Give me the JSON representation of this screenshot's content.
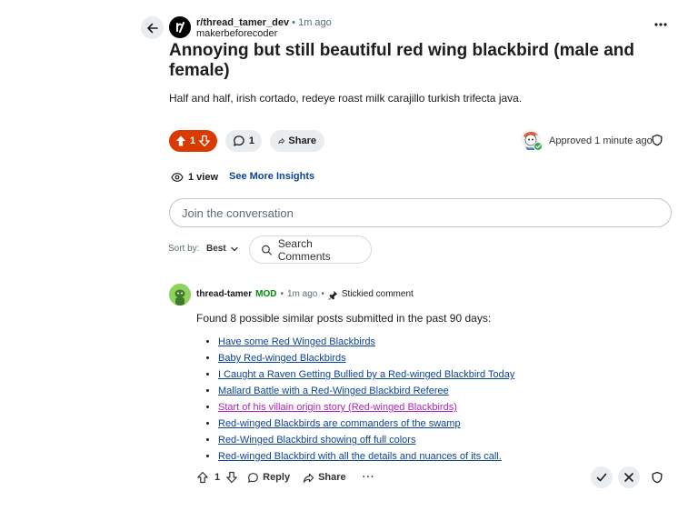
{
  "post": {
    "subreddit": "r/thread_tamer_dev",
    "separator": "•",
    "time": "1m ago",
    "author": "makerbeforecoder",
    "title": "Annoying but still beautiful red wing blackbird (male and female)",
    "body": "Half and half, irish cortado, redeye roast milk carajillo turkish trifecta java.",
    "score": "1",
    "comments_count": "1",
    "share_label": "Share",
    "approved_text": "Approved 1 minute ago",
    "views": "1 view",
    "insights_label": "See More Insights"
  },
  "composer": {
    "placeholder": "Join the conversation"
  },
  "sort": {
    "label": "Sort by:",
    "value": "Best",
    "search_label": "Search Comments"
  },
  "comment": {
    "author": "thread-tamer",
    "mod_badge": "MOD",
    "separator": "•",
    "time": "1m ago",
    "stickied": "Stickied comment",
    "text": "Found 8 possible similar posts submitted in the past 90 days:",
    "links": [
      "Have some Red Winged Blackbirds",
      "Baby Red-winged Blackbirds",
      "I Caught a Raven Getting Bullied by a Red-winged Blackbird Today",
      "Mallard Battle with a Red-Winged Blackbird Referee",
      "Start of his villain origin story (Red-winged Blackbirds)",
      "Red-winged Blackbirds are commanders of the swamp",
      "Red-Winged Blackbird showing off full colors",
      "Red-winged Blackbird with all the details and nuances of its call."
    ],
    "score": "1",
    "reply_label": "Reply",
    "share_label": "Share",
    "more_label": "···"
  },
  "colors": {
    "upvote_active": "#d93a00",
    "link": "#0a449b",
    "visited_link": "#b51ebf",
    "mod": "#008a10"
  }
}
